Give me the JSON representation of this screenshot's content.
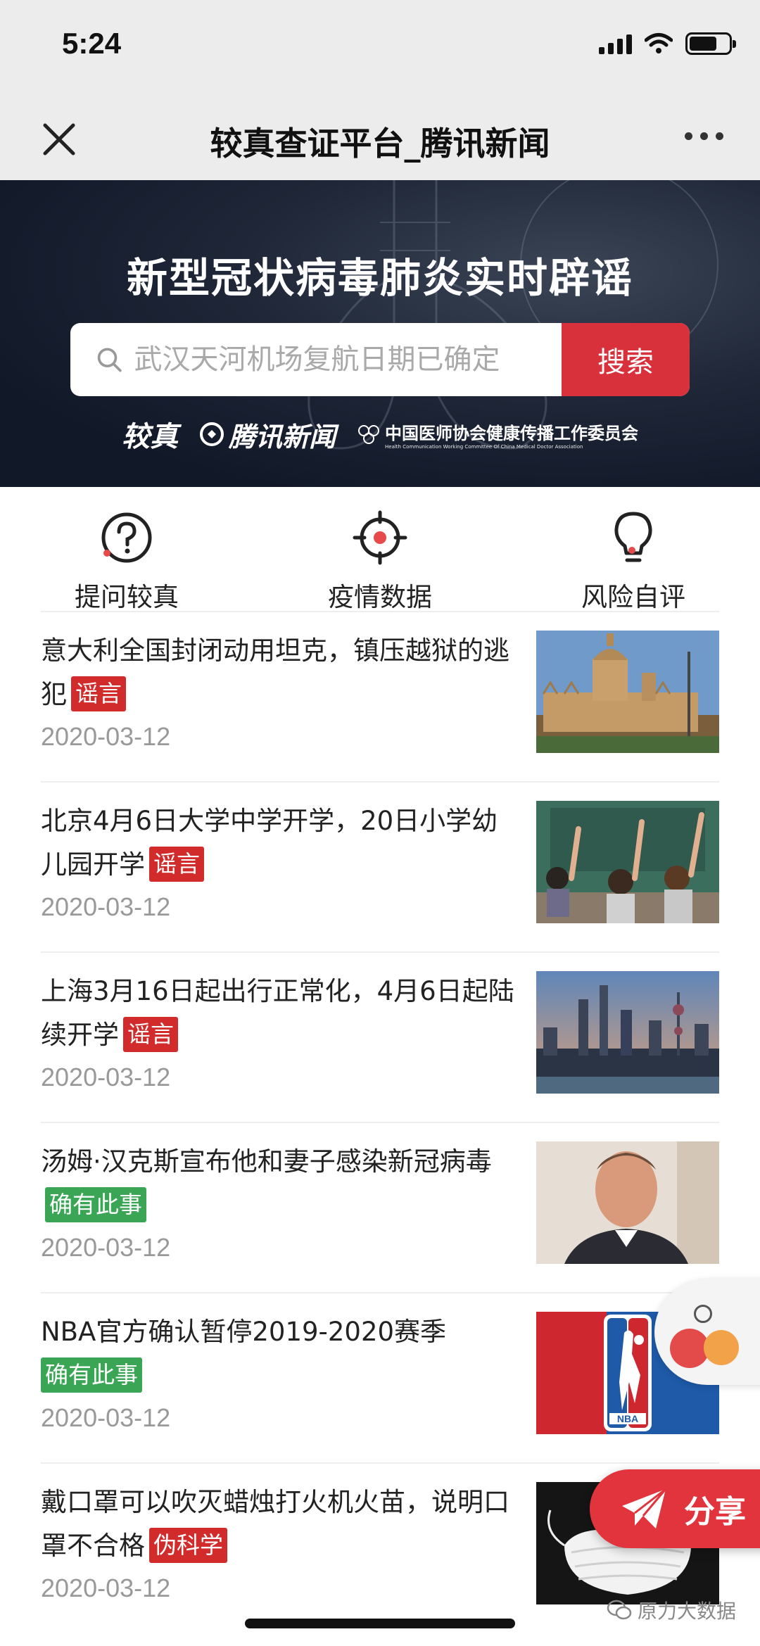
{
  "status_bar": {
    "time": "5:24"
  },
  "nav": {
    "title": "较真查证平台_腾讯新闻"
  },
  "banner": {
    "title": "新型冠状病毒肺炎实时辟谣",
    "search_placeholder": "武汉天河机场复航日期已确定",
    "search_button": "搜索",
    "logos": {
      "jiaozhen": "较真",
      "tencent": "腾讯新闻",
      "assoc_cn": "中国医师协会健康传播工作委员会",
      "assoc_en": "Health Communication Working Committee Of China Medical Doctor Association"
    }
  },
  "actions": [
    {
      "label": "提问较真",
      "icon": "question-icon"
    },
    {
      "label": "疫情数据",
      "icon": "target-icon"
    },
    {
      "label": "风险自评",
      "icon": "lightbulb-icon"
    }
  ],
  "news": [
    {
      "title": "意大利全国封闭动用坦克，镇压越狱的逃犯",
      "tag": "谣言",
      "tag_type": "rumor",
      "date": "2020-03-12",
      "thumb": "cathedral-photo"
    },
    {
      "title": "北京4月6日大学中学开学，20日小学幼儿园开学",
      "tag": "谣言",
      "tag_type": "rumor",
      "date": "2020-03-12",
      "thumb": "classroom-photo"
    },
    {
      "title": "上海3月16日起出行正常化，4月6日起陆续开学",
      "tag": "谣言",
      "tag_type": "rumor",
      "date": "2020-03-12",
      "thumb": "shanghai-skyline-photo"
    },
    {
      "title": "汤姆·汉克斯宣布他和妻子感染新冠病毒",
      "tag": "确有此事",
      "tag_type": "true",
      "date": "2020-03-12",
      "thumb": "portrait-photo"
    },
    {
      "title": "NBA官方确认暂停2019-2020赛季",
      "tag": "确有此事",
      "tag_type": "true",
      "date": "2020-03-12",
      "thumb": "nba-logo"
    },
    {
      "title": "戴口罩可以吹灭蜡烛打火机火苗，说明口罩不合格",
      "tag": "伪科学",
      "tag_type": "fake",
      "date": "2020-03-12",
      "thumb": "mask-photo"
    }
  ],
  "share": {
    "label": "分享"
  },
  "watermark": "原力大数据",
  "colors": {
    "accent_red": "#d9313b",
    "tag_rumor": "#d22b2b",
    "tag_true": "#3aa655",
    "banner_bg": "#1f2738"
  }
}
